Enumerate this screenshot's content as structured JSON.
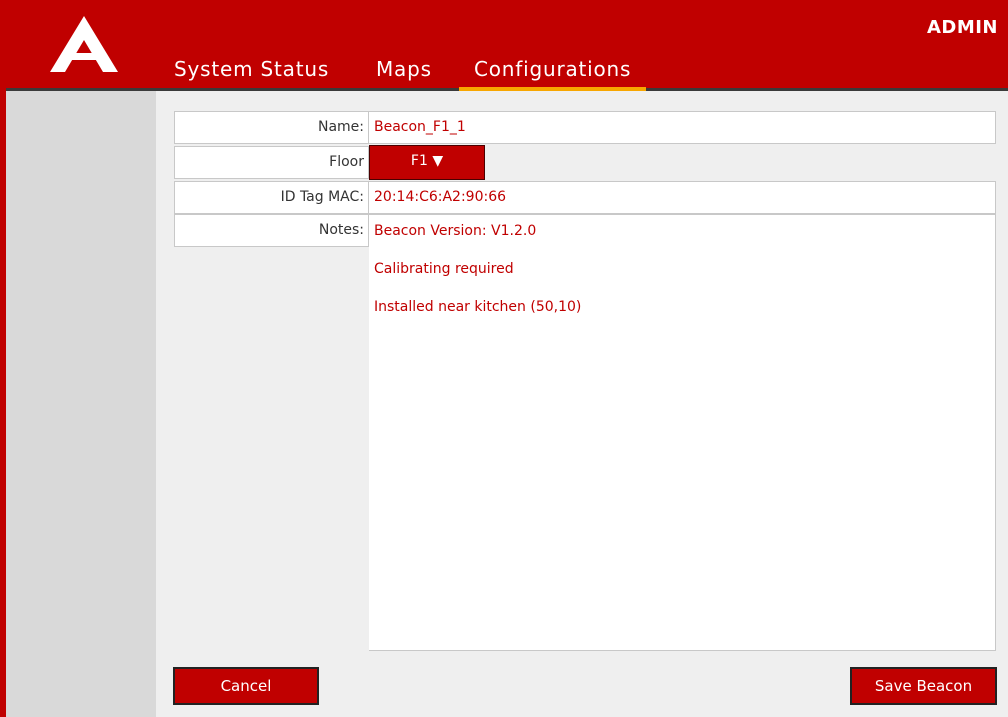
{
  "header": {
    "user_role": "ADMIN",
    "tabs": [
      {
        "label": "System Status"
      },
      {
        "label": "Maps"
      },
      {
        "label": "Configurations"
      }
    ],
    "active_tab": "Configurations"
  },
  "form": {
    "name_label": "Name:",
    "name_value": "Beacon_F1_1",
    "floor_label": "Floor",
    "floor_value": "F1 ▼",
    "mac_label": "ID Tag MAC:",
    "mac_value": "20:14:C6:A2:90:66",
    "notes_label": "Notes:",
    "notes_lines": [
      "Beacon Version: V1.2.0",
      "Calibrating required",
      "Installed near kitchen (50,10)"
    ]
  },
  "buttons": {
    "cancel": "Cancel",
    "save": "Save Beacon"
  },
  "colors": {
    "brand_red": "#c00000",
    "active_tab_underline": "#f7a600",
    "sidebar": "#d9d9d9"
  },
  "icons": {
    "logo": "a-logo-icon",
    "floor_dropdown": "caret-down-icon"
  }
}
